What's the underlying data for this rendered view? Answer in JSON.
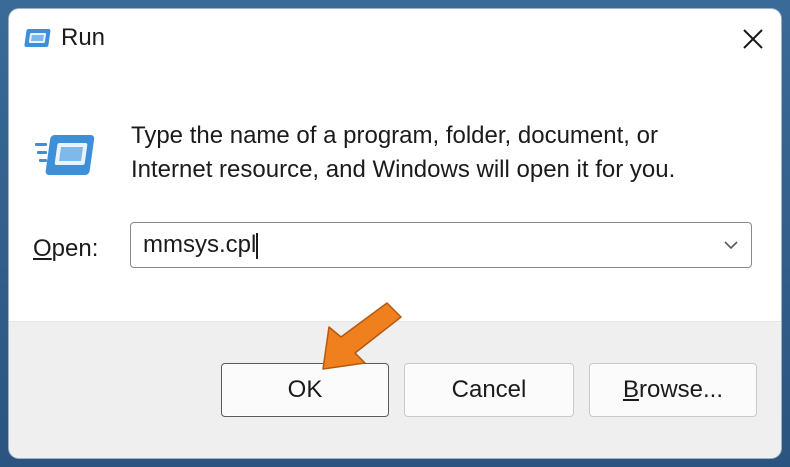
{
  "window": {
    "title": "Run",
    "icon": "run-icon",
    "close_icon": "close-icon"
  },
  "description": {
    "line1": "Type the name of a program, folder, document, or",
    "line2": "Internet resource, and Windows will open it for you."
  },
  "open_field": {
    "label_accel": "O",
    "label_rest": "pen:",
    "value": "mmsys.cpl",
    "dropdown_icon": "chevron-down-icon"
  },
  "buttons": {
    "ok": "OK",
    "cancel": "Cancel",
    "browse_accel": "B",
    "browse_rest": "rowse..."
  },
  "annotation": {
    "arrow_icon": "pointer-arrow-icon",
    "arrow_color": "#f07f1e"
  },
  "colors": {
    "background": "#2f5a86",
    "dialog": "#ffffff",
    "footer": "#efefef",
    "icon_blue": "#3d8fd8"
  }
}
